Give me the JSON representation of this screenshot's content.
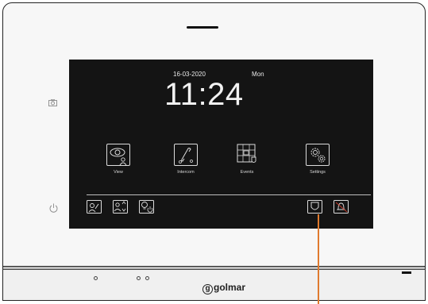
{
  "screen": {
    "date": "16-03-2020",
    "day": "Mon",
    "time": "11:24"
  },
  "apps": [
    {
      "label": "View",
      "icon": "view-icon"
    },
    {
      "label": "Intercom",
      "icon": "intercom-icon"
    },
    {
      "label": "Events",
      "icon": "events-icon"
    },
    {
      "label": "Settings",
      "icon": "settings-icon"
    }
  ],
  "bottom_bar": {
    "left_icons": [
      "door-call-icon",
      "user-sort-icon",
      "light-power-icon"
    ],
    "right_icons": [
      "security-shield-icon",
      "do-not-disturb-icon"
    ]
  },
  "device": {
    "brand": "golmar",
    "side_icons": [
      "camera-icon",
      "power-icon"
    ]
  },
  "colors": {
    "callout": "#e07a2e",
    "screen": "#141414"
  }
}
